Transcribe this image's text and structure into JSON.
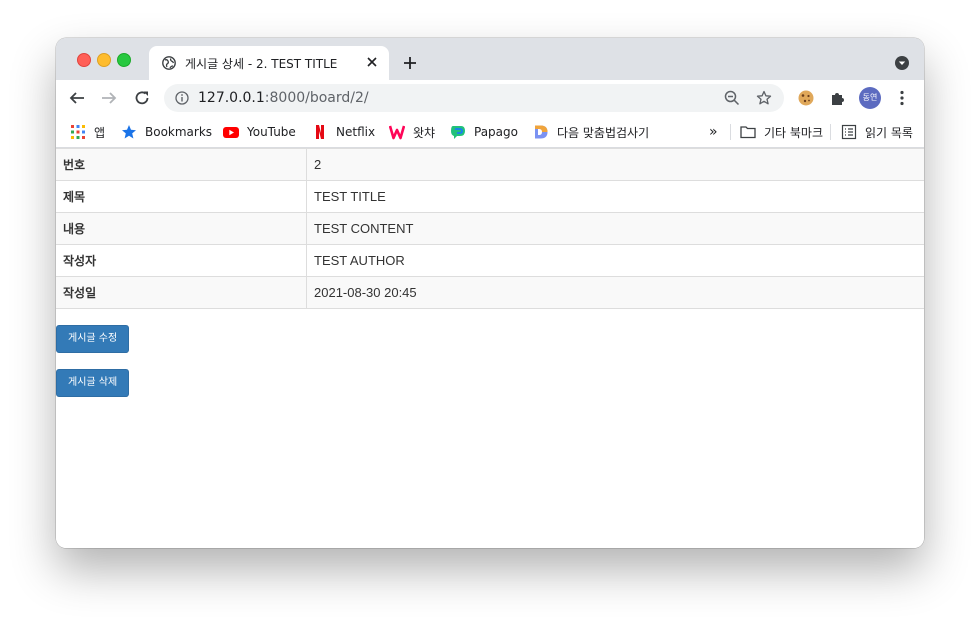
{
  "browser": {
    "tab": {
      "title": "게시글 상세 - 2. TEST TITLE"
    },
    "url": {
      "host": "127.0.0.1",
      "rest": ":8000/board/2/"
    },
    "profile_avatar": "동연",
    "bookmarks": [
      {
        "label": "앱",
        "icon": "apps-grid-icon"
      },
      {
        "label": "Bookmarks",
        "icon": "star-icon"
      },
      {
        "label": "YouTube",
        "icon": "youtube-icon"
      },
      {
        "label": "Netflix",
        "icon": "netflix-icon"
      },
      {
        "label": "왓챠",
        "icon": "watcha-icon"
      },
      {
        "label": "Papago",
        "icon": "papago-icon"
      },
      {
        "label": "다음 맞춤법검사기",
        "icon": "daum-icon"
      }
    ],
    "bookmarks_overflow": "»",
    "other_bookmarks": "기타 북마크",
    "reading_list": "읽기 목록"
  },
  "post": {
    "rows": [
      {
        "label": "번호",
        "value": "2"
      },
      {
        "label": "제목",
        "value": "TEST TITLE"
      },
      {
        "label": "내용",
        "value": "TEST CONTENT"
      },
      {
        "label": "작성자",
        "value": "TEST AUTHOR"
      },
      {
        "label": "작성일",
        "value": "2021-08-30 20:45"
      }
    ],
    "edit_button": "게시글 수정",
    "delete_button": "게시글 삭제"
  },
  "colors": {
    "primary_button": "#337ab7",
    "tab_strip": "#dee1e6"
  }
}
